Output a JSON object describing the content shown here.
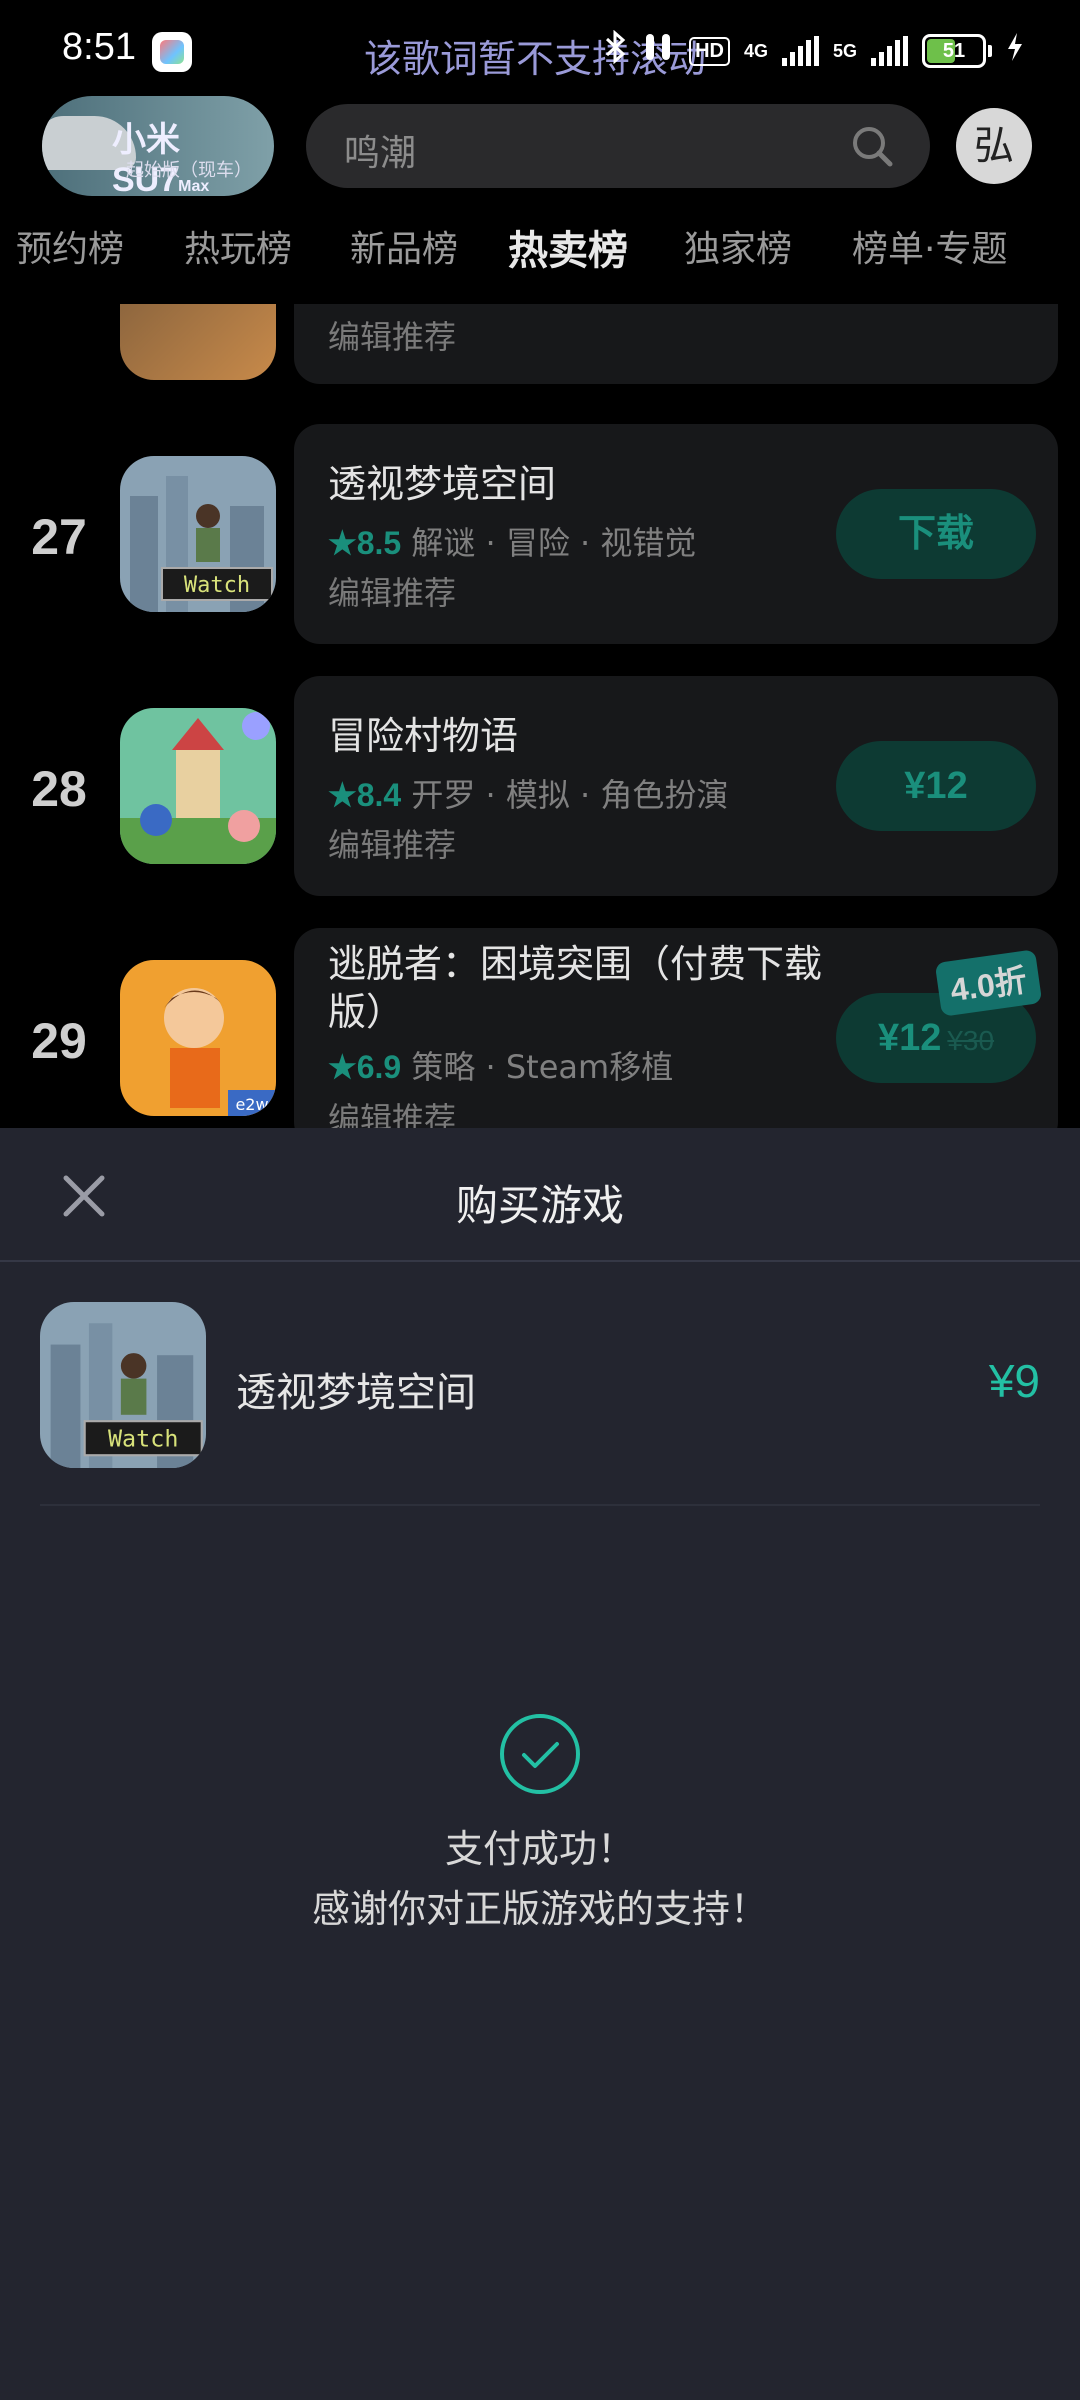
{
  "status_bar": {
    "time": "8:51",
    "lyric": "该歌词暂不支持滚动",
    "hd": "HD",
    "net1": "4G",
    "net2": "5G",
    "battery": "51",
    "battery_level": 0.51,
    "icons": [
      "bluetooth-icon",
      "earbuds-icon",
      "signal-icon",
      "charging-icon"
    ]
  },
  "header": {
    "banner_title": "小米SU7",
    "banner_max": "Max",
    "banner_sub": "起始版（现车）",
    "search_placeholder": "鸣潮",
    "avatar_text": "弘"
  },
  "tabs": [
    {
      "label": "预约榜"
    },
    {
      "label": "热玩榜"
    },
    {
      "label": "新品榜"
    },
    {
      "label": "热卖榜",
      "active": true
    },
    {
      "label": "独家榜"
    },
    {
      "label": "榜单·专题"
    }
  ],
  "list": {
    "partial_row": {
      "rec": "编辑推荐"
    },
    "rows": [
      {
        "rank": "27",
        "name": "透视梦境空间",
        "rating": "★8.5",
        "tags": "解谜 · 冒险 · 视错觉",
        "rec": "编辑推荐",
        "button": "下载"
      },
      {
        "rank": "28",
        "name": "冒险村物语",
        "rating": "★8.4",
        "tags": "开罗 · 模拟 · 角色扮演",
        "rec": "编辑推荐",
        "button": "¥12"
      },
      {
        "rank": "29",
        "name": "逃脱者：困境突围（付费下载版）",
        "rating": "★6.9",
        "tags": "策略 · Steam移植",
        "rec": "编辑推荐",
        "button": "¥12",
        "original_price": "¥30",
        "discount": "4.0折"
      }
    ]
  },
  "sheet": {
    "title": "购买游戏",
    "item_name": "透视梦境空间",
    "item_price": "¥9",
    "icon_badge": "Watch",
    "success_line1": "支付成功！",
    "success_line2": "感谢你对正版游戏的支持！"
  },
  "colors": {
    "accent": "#23c0a4",
    "sheet_bg": "#23252f",
    "card_bg": "#17181a"
  }
}
